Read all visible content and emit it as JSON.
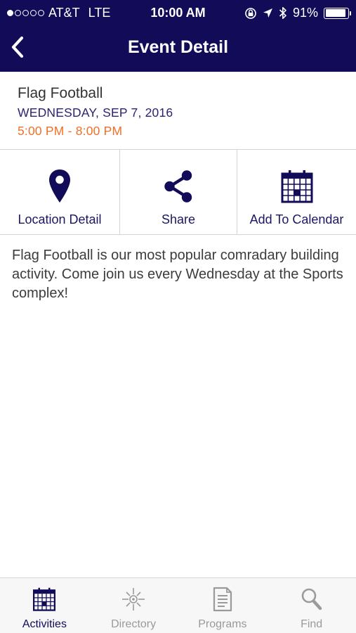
{
  "status_bar": {
    "carrier": "AT&T",
    "network": "LTE",
    "time": "10:00 AM",
    "battery": "91%",
    "battery_level": 0.91
  },
  "nav": {
    "title": "Event Detail",
    "back_icon": "chevron-left-icon"
  },
  "event": {
    "title": "Flag Football",
    "date": "WEDNESDAY, SEP 7, 2016",
    "time": "5:00 PM - 8:00 PM"
  },
  "actions": [
    {
      "label": "Location Detail",
      "icon": "location-pin-icon"
    },
    {
      "label": "Share",
      "icon": "share-icon"
    },
    {
      "label": "Add To Calendar",
      "icon": "calendar-icon"
    }
  ],
  "description": "Flag Football is our most popular comradary building activity. Come join us every Wednesday at the Sports complex!",
  "tabs": [
    {
      "label": "Activities",
      "icon": "calendar-icon",
      "active": true
    },
    {
      "label": "Directory",
      "icon": "compass-icon",
      "active": false
    },
    {
      "label": "Programs",
      "icon": "document-icon",
      "active": false
    },
    {
      "label": "Find",
      "icon": "search-icon",
      "active": false
    }
  ],
  "colors": {
    "brand": "#120c58",
    "accent_time": "#f0702a",
    "date_text": "#2a2470",
    "tab_inactive": "#9a9a9a"
  }
}
